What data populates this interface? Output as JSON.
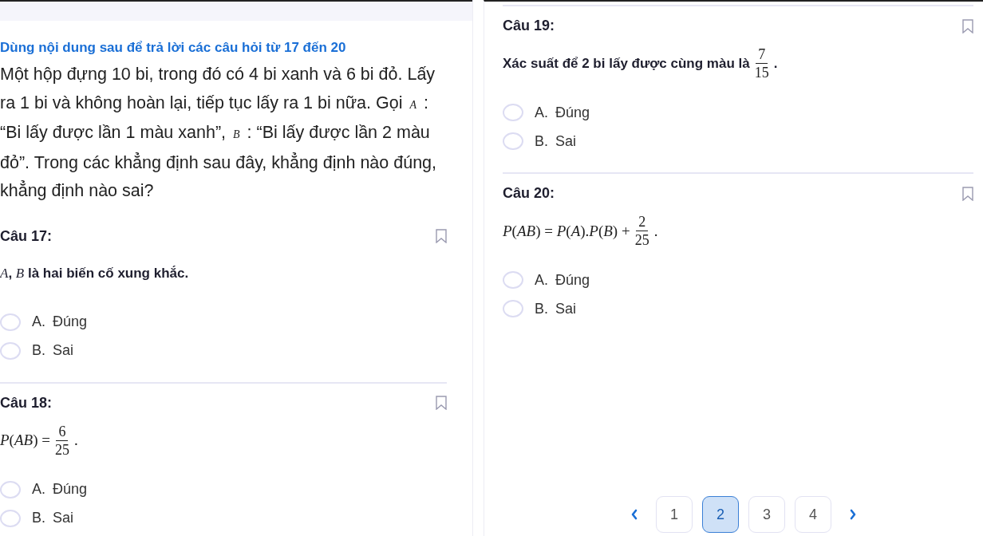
{
  "intro": {
    "title": "Dùng nội dung sau để trả lời các câu hỏi từ 17 đến 20",
    "text": "Một hộp đựng 10 bi, trong đó có 4 bi xanh và 6 bi đỏ. Lấy ra 1 bi và không hoàn lại, tiếp tục lấy ra 1 bi nữa. Gọi *A* : “Bi lấy được lần 1 màu xanh”, *B* : “Bi lấy được lần 2 màu đỏ”. Trong các khẳng định sau đây, khẳng định nào đúng, khẳng định nào sai?"
  },
  "left_questions": [
    {
      "title": "Câu 17:",
      "statement": {
        "kind": "text",
        "text": "*A*, *B* là hai biến cố xung khắc."
      },
      "options": [
        {
          "text": "A. Đúng",
          "selected": false
        },
        {
          "text": "B. Sai",
          "selected": false
        }
      ]
    },
    {
      "title": "Câu 18:",
      "statement": {
        "kind": "math_fraction",
        "before": "*P*(*AB*) =",
        "numerator": "6",
        "denominator": "25",
        "after": "."
      },
      "options": [
        {
          "text": "A. Đúng",
          "selected": false
        },
        {
          "text": "B. Sai",
          "selected": false
        }
      ]
    }
  ],
  "right_questions": [
    {
      "title": "Câu 19:",
      "statement": {
        "kind": "text_fraction",
        "before": "Xác suất để 2 bi lấy được cùng màu là",
        "numerator": "7",
        "denominator": "15",
        "after": "."
      },
      "options": [
        {
          "text": "A. Đúng",
          "selected": false
        },
        {
          "text": "B. Sai",
          "selected": false
        }
      ]
    },
    {
      "title": "Câu 20:",
      "statement": {
        "kind": "math_fraction",
        "before": "*P*(*AB*) = *P*(*A*).*P*(*B*) +",
        "numerator": "2",
        "denominator": "25",
        "after": "."
      },
      "options": [
        {
          "text": "A. Đúng",
          "selected": false
        },
        {
          "text": "B. Sai",
          "selected": false
        }
      ]
    }
  ],
  "pagination": {
    "pages": [
      {
        "label": "1",
        "selected": false
      },
      {
        "label": "2",
        "selected": true
      },
      {
        "label": "3",
        "selected": false
      },
      {
        "label": "4",
        "selected": false
      }
    ]
  }
}
